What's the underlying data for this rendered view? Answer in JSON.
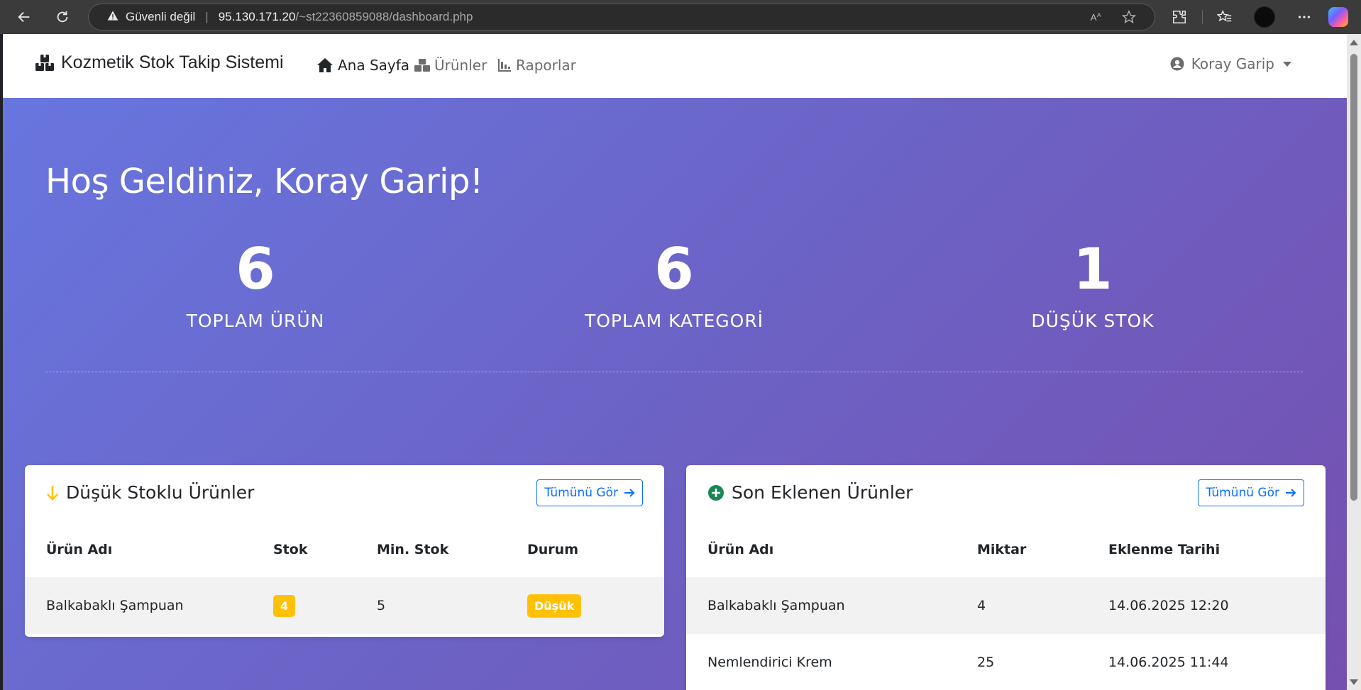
{
  "browser": {
    "security_label": "Güvenli değil",
    "url_host": "95.130.171.20",
    "url_path": "/~st22360859088/dashboard.php"
  },
  "navbar": {
    "brand": "Kozmetik Stok Takip Sistemi",
    "items": [
      {
        "label": "Ana Sayfa",
        "icon": "home-icon",
        "active": true
      },
      {
        "label": "Ürünler",
        "icon": "boxes-icon",
        "active": false
      },
      {
        "label": "Raporlar",
        "icon": "chart-icon",
        "active": false
      }
    ],
    "user": "Koray Garip"
  },
  "hero": {
    "welcome": "Hoş Geldiniz, Koray Garip!",
    "stats": [
      {
        "value": "6",
        "label": "TOPLAM ÜRÜN"
      },
      {
        "value": "6",
        "label": "TOPLAM KATEGORİ"
      },
      {
        "value": "1",
        "label": "DÜŞÜK STOK"
      }
    ]
  },
  "low_stock": {
    "title": "Düşük Stoklu Ürünler",
    "view_all": "Tümünü Gör",
    "columns": [
      "Ürün Adı",
      "Stok",
      "Min. Stok",
      "Durum"
    ],
    "rows": [
      {
        "name": "Balkabaklı Şampuan",
        "stock": "4",
        "min_stock": "5",
        "status": "Düşük"
      }
    ]
  },
  "recent": {
    "title": "Son Eklenen Ürünler",
    "view_all": "Tümünü Gör",
    "columns": [
      "Ürün Adı",
      "Miktar",
      "Eklenme Tarihi"
    ],
    "rows": [
      {
        "name": "Balkabaklı Şampuan",
        "qty": "4",
        "date": "14.06.2025 12:20"
      },
      {
        "name": "Nemlendirici Krem",
        "qty": "25",
        "date": "14.06.2025 11:44"
      }
    ]
  },
  "colors": {
    "accent": "#0d6efd",
    "warning": "#ffc107",
    "success": "#198754",
    "gradient_start": "#6777e0",
    "gradient_end": "#7550b0"
  }
}
